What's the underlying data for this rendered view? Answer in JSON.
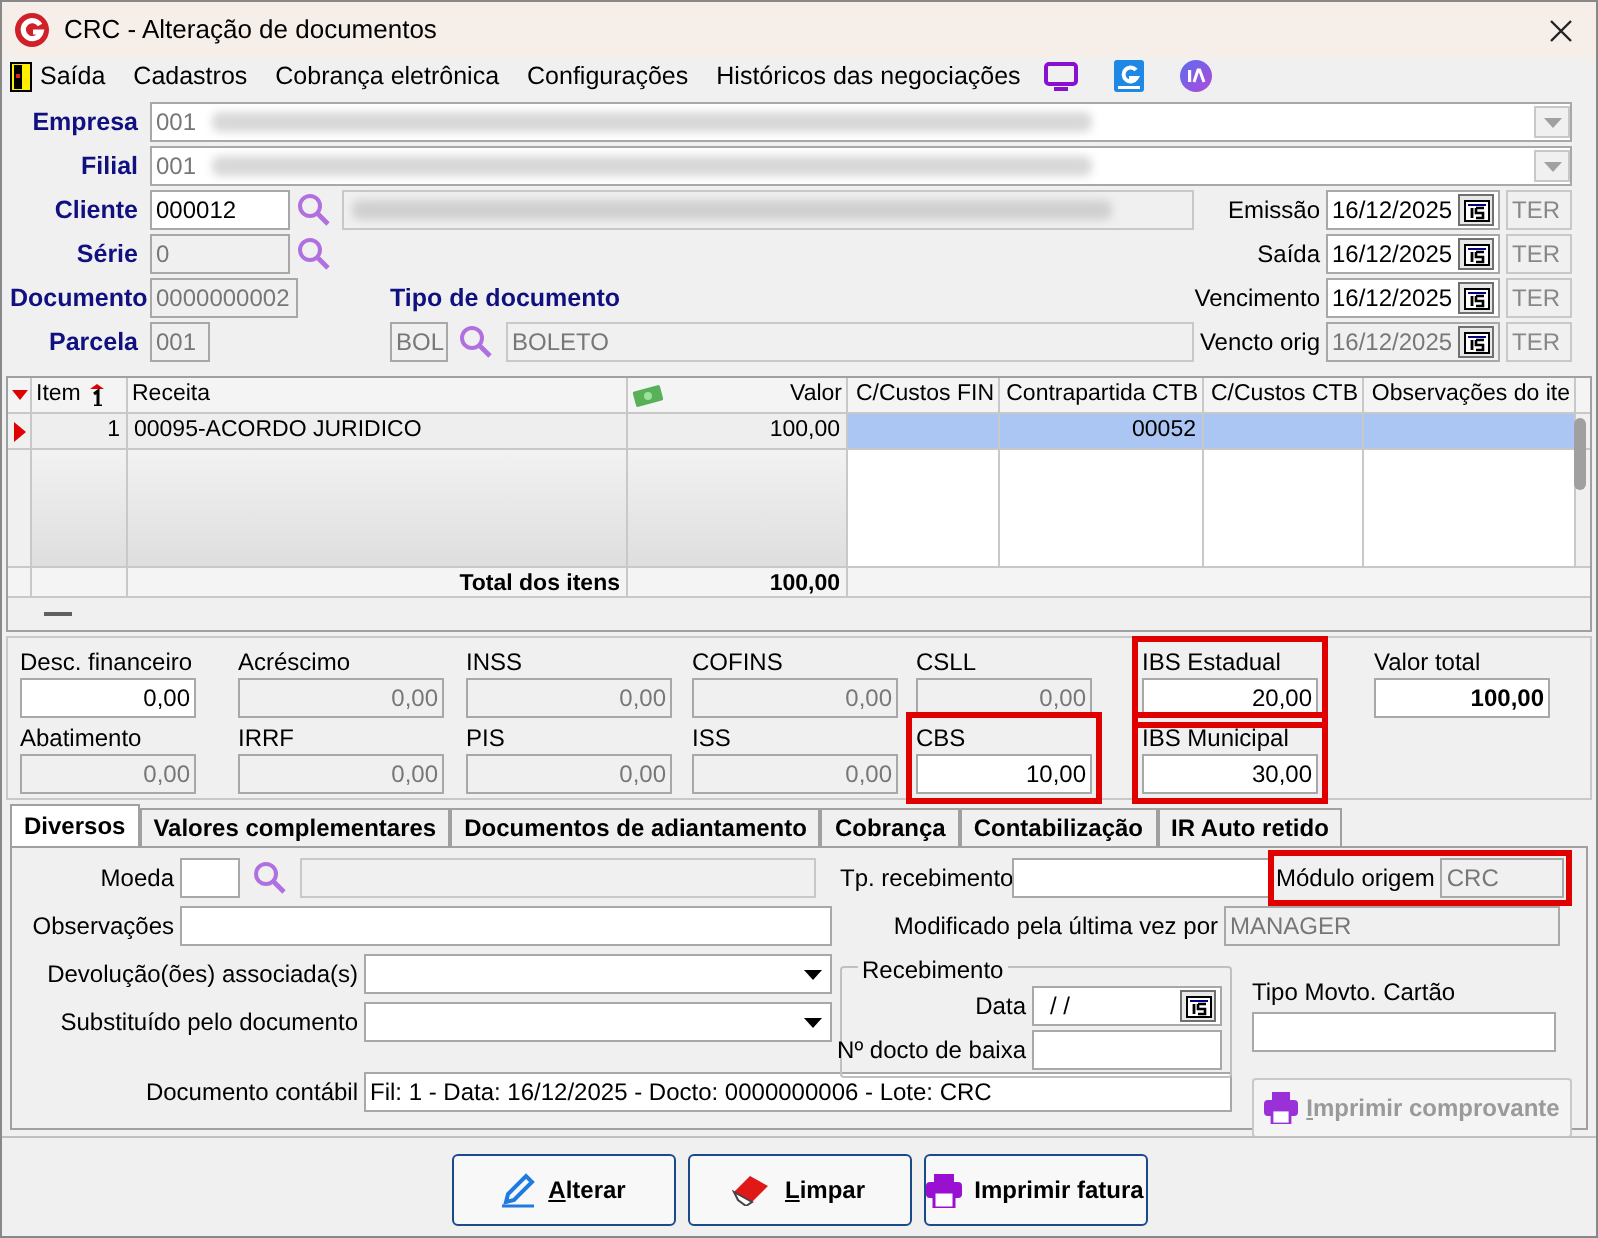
{
  "window": {
    "title": "CRC - Alteração de documentos"
  },
  "menu": [
    {
      "label": "Saída"
    },
    {
      "label": "Cadastros"
    },
    {
      "label": "Cobrança eletrônica"
    },
    {
      "label": "Configurações"
    },
    {
      "label": "Históricos das negociações"
    }
  ],
  "header": {
    "empresa": {
      "label": "Empresa",
      "value": "001"
    },
    "filial": {
      "label": "Filial",
      "value": "001"
    },
    "cliente": {
      "label": "Cliente",
      "value": "000012"
    },
    "serie": {
      "label": "Série",
      "value": "0"
    },
    "documento": {
      "label": "Documento",
      "value": "0000000002"
    },
    "parcela": {
      "label": "Parcela",
      "value": "001"
    },
    "tipo_documento": {
      "label": "Tipo de documento",
      "code": "BOL",
      "name": "BOLETO"
    },
    "dates": [
      {
        "label": "Emissão",
        "value": "16/12/2025",
        "weekday": "TER",
        "disabled": false
      },
      {
        "label": "Saída",
        "value": "16/12/2025",
        "weekday": "TER",
        "disabled": false
      },
      {
        "label": "Vencimento",
        "value": "16/12/2025",
        "weekday": "TER",
        "disabled": false
      },
      {
        "label": "Vencto orig",
        "value": "16/12/2025",
        "weekday": "TER",
        "disabled": true
      }
    ]
  },
  "items_grid": {
    "columns": [
      {
        "label": "Item"
      },
      {
        "label": "Receita"
      },
      {
        "label": "Valor"
      },
      {
        "label": "C/Custos FIN"
      },
      {
        "label": "Contrapartida CTB"
      },
      {
        "label": "C/Custos CTB"
      },
      {
        "label": "Observações do ite"
      }
    ],
    "rows": [
      {
        "item": "1",
        "receita": "00095-ACORDO JURIDICO",
        "valor": "100,00",
        "contrapartida_ctb": "00052",
        "selected": true
      }
    ],
    "totals": {
      "label": "Total dos itens",
      "value": "100,00"
    }
  },
  "taxes": [
    [
      {
        "label": "Desc. financeiro",
        "value": "0,00",
        "disabled": false,
        "highlighted": false,
        "bold": false
      },
      {
        "label": "Acréscimo",
        "value": "0,00",
        "disabled": true,
        "highlighted": false,
        "bold": false
      },
      {
        "label": "INSS",
        "value": "0,00",
        "disabled": true,
        "highlighted": false,
        "bold": false
      },
      {
        "label": "COFINS",
        "value": "0,00",
        "disabled": true,
        "highlighted": false,
        "bold": false
      },
      {
        "label": "CSLL",
        "value": "0,00",
        "disabled": true,
        "highlighted": false,
        "bold": false
      },
      {
        "label": "IBS Estadual",
        "value": "20,00",
        "disabled": false,
        "highlighted": true,
        "bold": false
      },
      {
        "label": "Valor total",
        "value": "100,00",
        "disabled": false,
        "highlighted": false,
        "bold": true
      }
    ],
    [
      {
        "label": "Abatimento",
        "value": "0,00",
        "disabled": true,
        "highlighted": false,
        "bold": false
      },
      {
        "label": "IRRF",
        "value": "0,00",
        "disabled": true,
        "highlighted": false,
        "bold": false
      },
      {
        "label": "PIS",
        "value": "0,00",
        "disabled": true,
        "highlighted": false,
        "bold": false
      },
      {
        "label": "ISS",
        "value": "0,00",
        "disabled": true,
        "highlighted": false,
        "bold": false
      },
      {
        "label": "CBS",
        "value": "10,00",
        "disabled": false,
        "highlighted": true,
        "bold": false
      },
      {
        "label": "IBS Municipal",
        "value": "30,00",
        "disabled": false,
        "highlighted": true,
        "bold": false
      }
    ]
  ],
  "tabs": [
    {
      "label": "Diversos",
      "selected": true
    },
    {
      "label": "Valores complementares",
      "selected": false
    },
    {
      "label": "Documentos de adiantamento",
      "selected": false
    },
    {
      "label": "Cobrança",
      "selected": false
    },
    {
      "label": "Contabilização",
      "selected": false
    },
    {
      "label": "IR Auto retido",
      "selected": false
    }
  ],
  "diversos": {
    "moeda": {
      "label": "Moeda"
    },
    "observacoes": {
      "label": "Observações"
    },
    "devolucoes": {
      "label": "Devolução(ões) associada(s)"
    },
    "substituido": {
      "label": "Substituído pelo documento"
    },
    "documento_contabil": {
      "label": "Documento contábil",
      "value": "Fil: 1 - Data: 16/12/2025 - Docto: 0000000006 - Lote: CRC"
    },
    "tp_recebimento": {
      "label": "Tp. recebimento"
    },
    "modulo_origem": {
      "label": "Módulo origem",
      "value": "CRC",
      "highlighted": true
    },
    "modificado_por": {
      "label": "Modificado pela última vez por",
      "value": "MANAGER"
    },
    "recebimento": {
      "title": "Recebimento",
      "data_label": "Data",
      "data_value": "/ /",
      "baixa_label": "Nº docto de baixa"
    },
    "tipo_movto_cartao": {
      "label": "Tipo Movto. Cartão"
    },
    "imprimir_comprovante": {
      "label": "Imprimir comprovante",
      "disabled": true
    }
  },
  "buttons": [
    {
      "label": "Alterar",
      "kind": "edit"
    },
    {
      "label": "Limpar",
      "kind": "clear"
    },
    {
      "label": "Imprimir fatura",
      "kind": "print"
    }
  ]
}
